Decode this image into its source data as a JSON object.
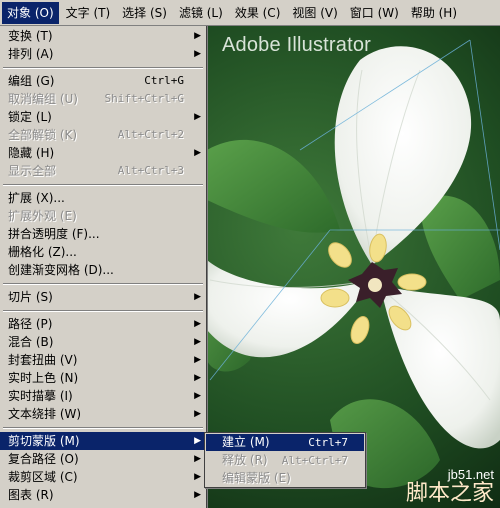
{
  "menubar": {
    "items": [
      {
        "label": "对象 (O)",
        "active": true
      },
      {
        "label": "文字 (T)"
      },
      {
        "label": "选择 (S)"
      },
      {
        "label": "滤镜 (L)"
      },
      {
        "label": "效果 (C)"
      },
      {
        "label": "视图 (V)"
      },
      {
        "label": "窗口 (W)"
      },
      {
        "label": "帮助 (H)"
      }
    ]
  },
  "dropdown": {
    "items": [
      {
        "label": "变换 (T)",
        "submenu": true
      },
      {
        "label": "排列 (A)",
        "submenu": true
      },
      {
        "label": "编组 (G)",
        "shortcut": "Ctrl+G"
      },
      {
        "label": "取消编组 (U)",
        "shortcut": "Shift+Ctrl+G",
        "disabled": true
      },
      {
        "label": "锁定 (L)",
        "submenu": true
      },
      {
        "label": "全部解锁 (K)",
        "shortcut": "Alt+Ctrl+2",
        "disabled": true
      },
      {
        "label": "隐藏 (H)",
        "submenu": true
      },
      {
        "label": "显示全部",
        "shortcut": "Alt+Ctrl+3",
        "disabled": true
      },
      {
        "label": "扩展 (X)..."
      },
      {
        "label": "扩展外观 (E)",
        "disabled": true
      },
      {
        "label": "拼合透明度 (F)..."
      },
      {
        "label": "栅格化 (Z)..."
      },
      {
        "label": "创建渐变网格 (D)..."
      },
      {
        "label": "切片 (S)",
        "submenu": true
      },
      {
        "label": "路径 (P)",
        "submenu": true
      },
      {
        "label": "混合 (B)",
        "submenu": true
      },
      {
        "label": "封套扭曲 (V)",
        "submenu": true
      },
      {
        "label": "实时上色 (N)",
        "submenu": true
      },
      {
        "label": "实时描摹 (I)",
        "submenu": true
      },
      {
        "label": "文本绕排 (W)",
        "submenu": true
      },
      {
        "label": "剪切蒙版 (M)",
        "submenu": true,
        "highlight": true
      },
      {
        "label": "复合路径 (O)",
        "submenu": true
      },
      {
        "label": "裁剪区域 (C)",
        "submenu": true
      },
      {
        "label": "图表 (R)",
        "submenu": true
      }
    ]
  },
  "submenu": {
    "items": [
      {
        "label": "建立 (M)",
        "shortcut": "Ctrl+7",
        "highlight": true
      },
      {
        "label": "释放 (R)",
        "shortcut": "Alt+Ctrl+7",
        "disabled": true
      },
      {
        "label": "编辑蒙版 (E)",
        "disabled": true
      }
    ]
  },
  "canvas": {
    "watermark": "Adobe Illustrator"
  },
  "site_logo": {
    "url": "jb51.net",
    "name": "脚本之家"
  },
  "colors": {
    "menu_bg": "#d4d0c8",
    "highlight": "#0a246a",
    "disabled_text": "#8c8c8c"
  }
}
